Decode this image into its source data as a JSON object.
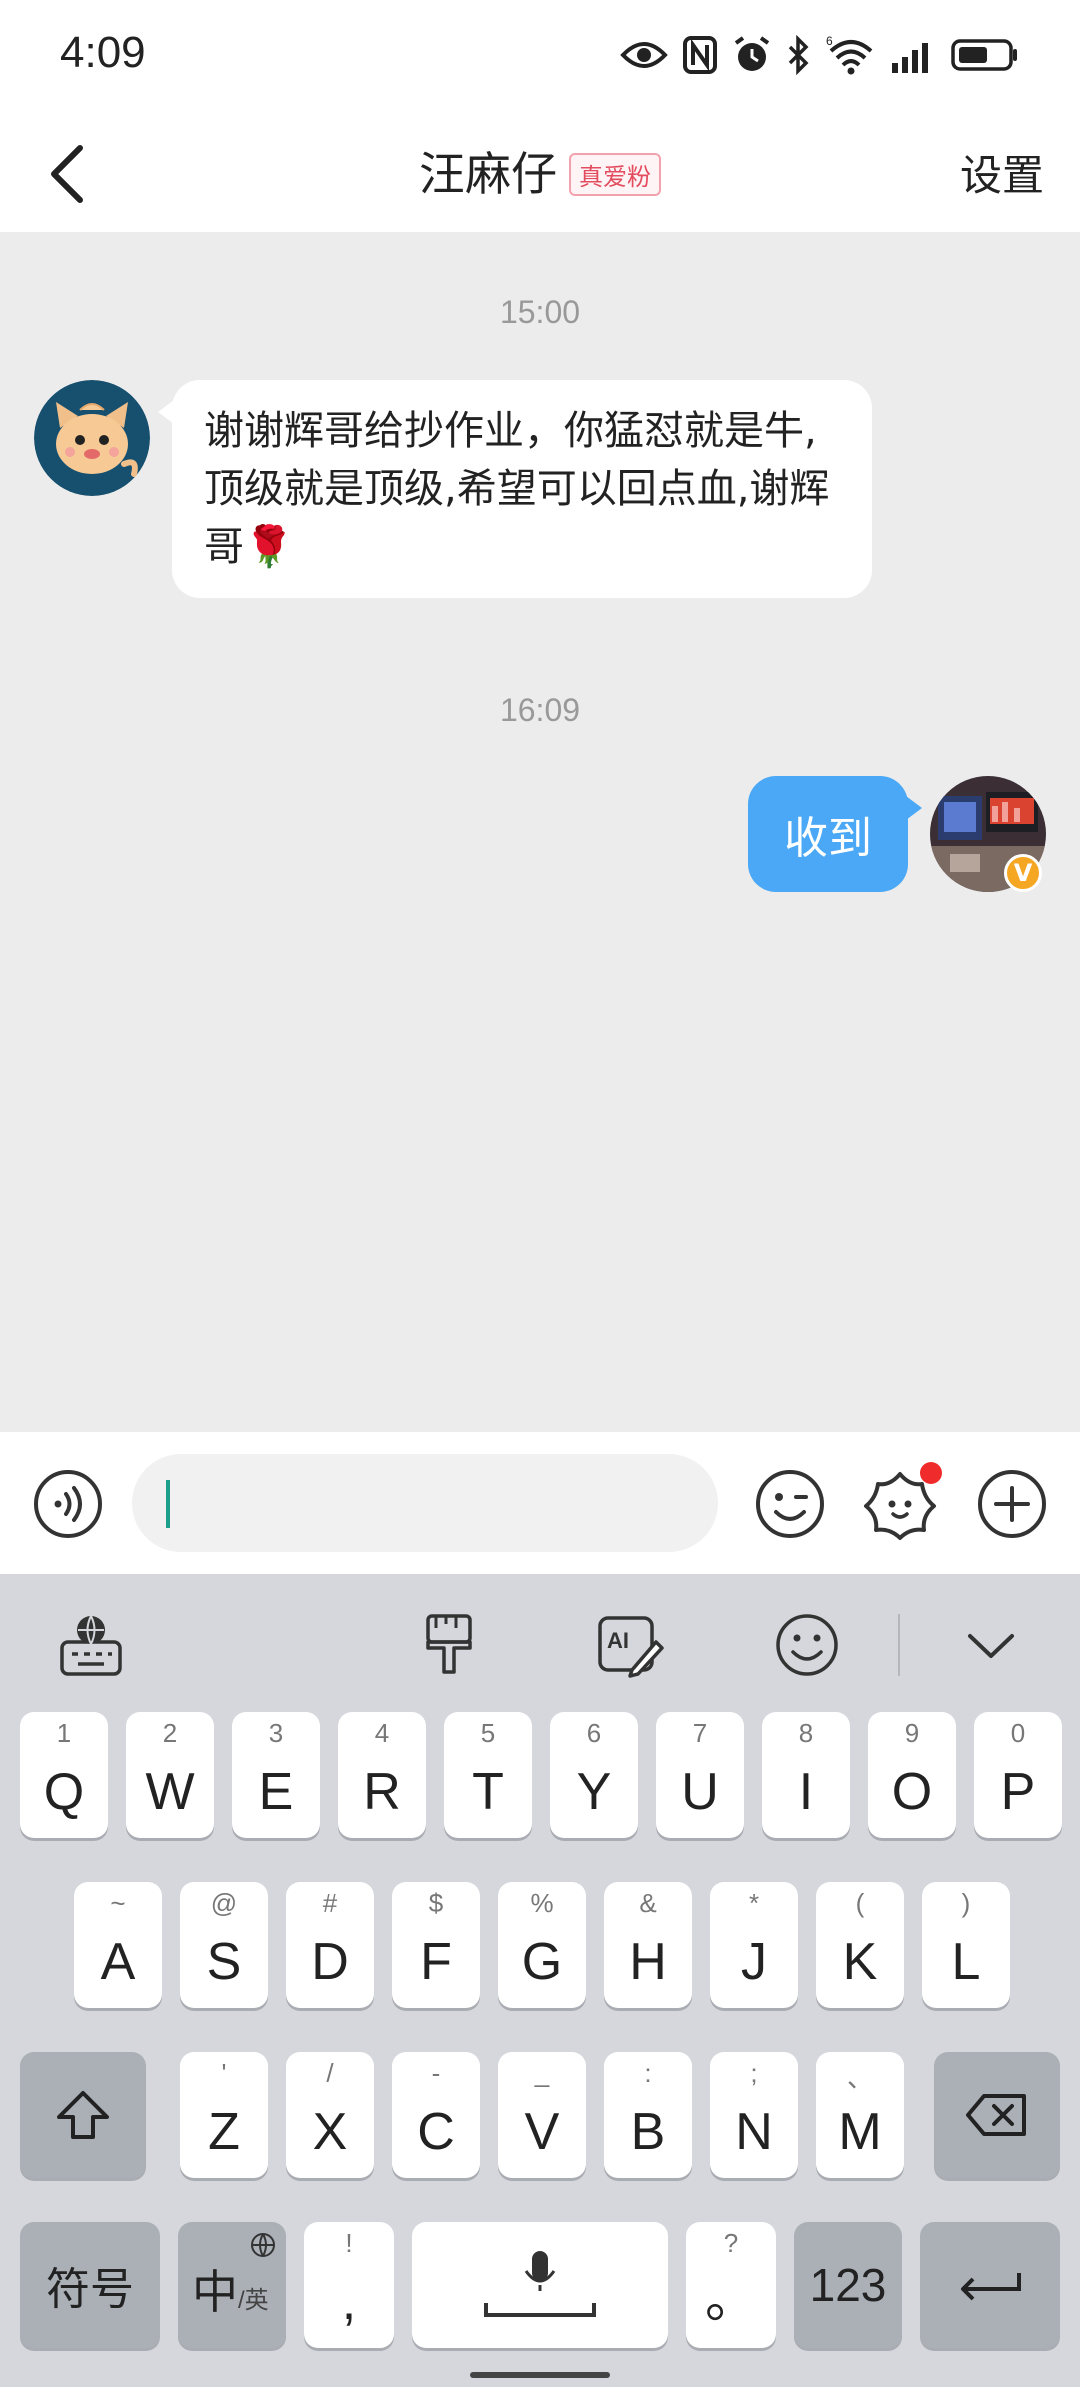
{
  "status_bar": {
    "time": "4:09",
    "icons": [
      "eye-icon",
      "nfc-icon",
      "alarm-icon",
      "bluetooth-icon",
      "wifi-icon",
      "signal-icon",
      "battery-icon"
    ],
    "wifi_label": "6"
  },
  "header": {
    "title": "汪麻仔",
    "badge": "真爱粉",
    "settings": "设置"
  },
  "chat": {
    "messages": [
      {
        "time": "15:00",
        "direction": "incoming",
        "text": "谢谢辉哥给抄作业，你猛怼就是牛,顶级就是顶级,希望可以回点血,谢辉哥🌹"
      },
      {
        "time": "16:09",
        "direction": "outgoing",
        "text": "收到",
        "badge": "V"
      }
    ]
  },
  "input_bar": {
    "text": ""
  },
  "keyboard": {
    "row1": [
      {
        "main": "Q",
        "sub": "1"
      },
      {
        "main": "W",
        "sub": "2"
      },
      {
        "main": "E",
        "sub": "3"
      },
      {
        "main": "R",
        "sub": "4"
      },
      {
        "main": "T",
        "sub": "5"
      },
      {
        "main": "Y",
        "sub": "6"
      },
      {
        "main": "U",
        "sub": "7"
      },
      {
        "main": "I",
        "sub": "8"
      },
      {
        "main": "O",
        "sub": "9"
      },
      {
        "main": "P",
        "sub": "0"
      }
    ],
    "row2": [
      {
        "main": "A",
        "sub": "~"
      },
      {
        "main": "S",
        "sub": "@"
      },
      {
        "main": "D",
        "sub": "#"
      },
      {
        "main": "F",
        "sub": "$"
      },
      {
        "main": "G",
        "sub": "%"
      },
      {
        "main": "H",
        "sub": "&"
      },
      {
        "main": "J",
        "sub": "*"
      },
      {
        "main": "K",
        "sub": "("
      },
      {
        "main": "L",
        "sub": ")"
      }
    ],
    "row3": [
      {
        "main": "Z",
        "sub": "'"
      },
      {
        "main": "X",
        "sub": "/"
      },
      {
        "main": "C",
        "sub": "-"
      },
      {
        "main": "V",
        "sub": "_"
      },
      {
        "main": "B",
        "sub": ":"
      },
      {
        "main": "N",
        "sub": ";"
      },
      {
        "main": "M",
        "sub": "、"
      }
    ],
    "symbols": "符号",
    "lang_main": "中",
    "lang_sub": "/英",
    "comma": ",",
    "comma_sub": "!",
    "period": "。",
    "period_sub": "?",
    "numbers": "123"
  }
}
